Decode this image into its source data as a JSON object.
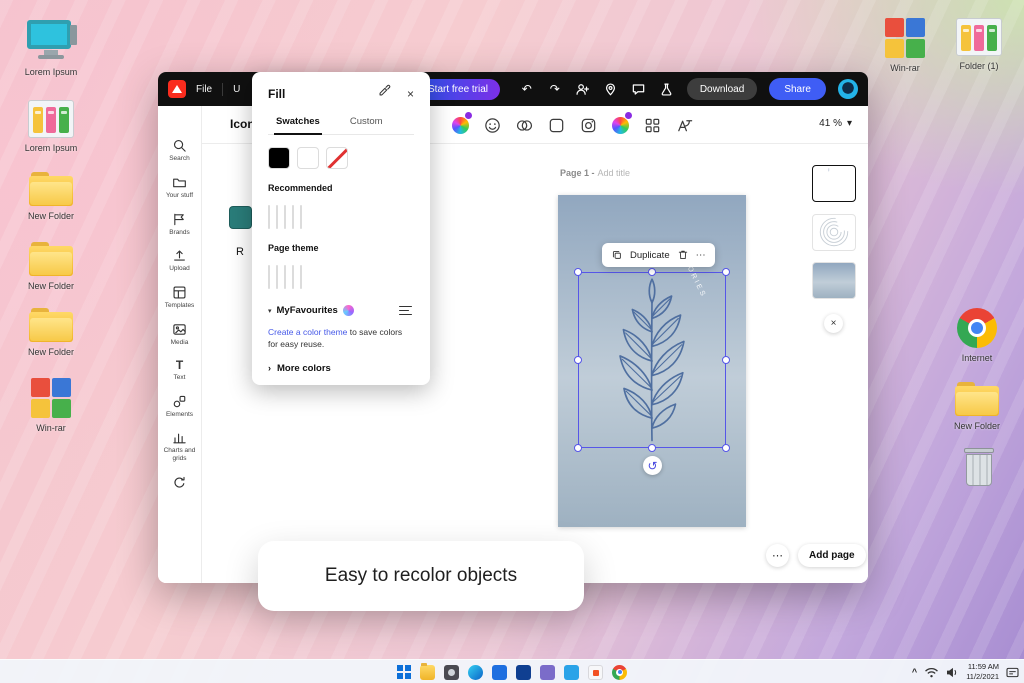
{
  "caption": "Easy to recolor objects",
  "glyphs": {
    "close": "×",
    "chevron_down": "▾",
    "chevron_right": "›",
    "ellipsis": "⋯",
    "undo": "↶",
    "redo": "↷",
    "rotate": "↺",
    "caret_up": "^",
    "text_tool": "T"
  },
  "colors": {
    "selection_accent": "#5656e8",
    "share_button": "#3f5df5",
    "trial_gradient_start": "#2a52e8",
    "trial_gradient_end": "#7c30e8"
  },
  "desktop": {
    "left_icons": [
      {
        "label": "Lorem Ipsum"
      },
      {
        "label": "Lorem Ipsum"
      },
      {
        "label": "New Folder"
      },
      {
        "label": "New Folder"
      },
      {
        "label": "New Folder"
      },
      {
        "label": "Win-rar"
      }
    ],
    "right_icons": [
      {
        "label": "Win-rar"
      },
      {
        "label": "Folder (1)"
      },
      {
        "label": "Internet"
      },
      {
        "label": "New Folder"
      },
      {
        "label": ""
      }
    ]
  },
  "window": {
    "header": {
      "menu_file": "File",
      "menu_partial": "U",
      "start_trial": "Start free trial",
      "download": "Download",
      "share": "Share"
    },
    "toolbar": {
      "icon_title": "Icon",
      "zoom": "41 %"
    },
    "properties": {
      "partial_label": "R",
      "fill_color": "#2a7d7a"
    },
    "sidebar": {
      "items": [
        {
          "label": "Search"
        },
        {
          "label": "Your stuff"
        },
        {
          "label": "Brands"
        },
        {
          "label": "Upload"
        },
        {
          "label": "Templates"
        },
        {
          "label": "Media"
        },
        {
          "label": "Text"
        },
        {
          "label": "Elements"
        },
        {
          "label": "Charts and grids"
        },
        {
          "label": ""
        }
      ]
    },
    "fill_panel": {
      "title": "Fill",
      "tab_swatches": "Swatches",
      "tab_custom": "Custom",
      "base_swatches": [
        "#000000",
        "#ffffff",
        "none"
      ],
      "recommended_label": "Recommended",
      "recommended_colors": [
        "#4d5c8c",
        "#23689f",
        "#2a7d7a",
        "#12a077",
        "#2e7d4f"
      ],
      "page_theme_label": "Page theme",
      "page_theme_colors": [
        "#0e403c",
        "#2a7d7a",
        "#ffffff",
        "#f6dc7d",
        "#ffffff"
      ],
      "favourites_label": "MyFavourites",
      "link_text": "Create a color theme",
      "link_rest": " to save colors for easy reuse.",
      "more_colors": "More colors"
    },
    "canvas": {
      "page_label": "Page 1 -",
      "add_title": "Add title",
      "duplicate": "Duplicate",
      "poster_text": "STORIES",
      "poster_gradient": "linear-gradient(180deg,#91a7bf 0%,#c0cdd8 55%,#9eb1c1 100%)",
      "plant_stroke": "#4f6fa0",
      "add_page": "Add page"
    }
  },
  "taskbar": {
    "time": "11:59 AM",
    "date": "11/2/2021"
  }
}
